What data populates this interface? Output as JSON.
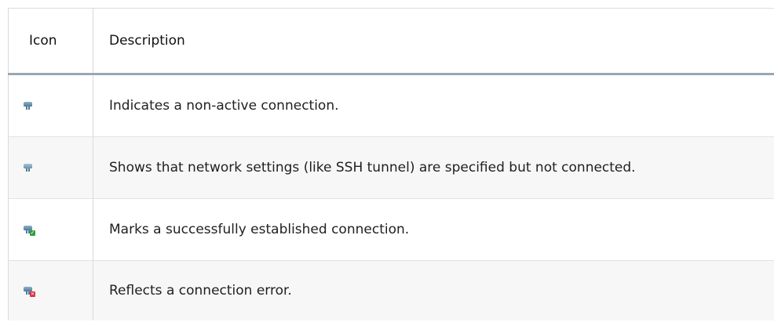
{
  "table": {
    "headers": {
      "icon": "Icon",
      "description": "Description"
    },
    "rows": [
      {
        "icon": "connection-inactive-icon",
        "description": "Indicates a non-active connection."
      },
      {
        "icon": "connection-network-configured-icon",
        "description": "Shows that network settings (like SSH tunnel) are specified but not connected."
      },
      {
        "icon": "connection-established-icon",
        "description": "Marks a successfully established connection."
      },
      {
        "icon": "connection-error-icon",
        "description": "Reflects a connection error."
      }
    ]
  },
  "colors": {
    "plug": "#4f7b99",
    "success_badge": "#2e9f3e",
    "error_badge": "#d7333a",
    "header_rule": "#9aa7b2"
  }
}
